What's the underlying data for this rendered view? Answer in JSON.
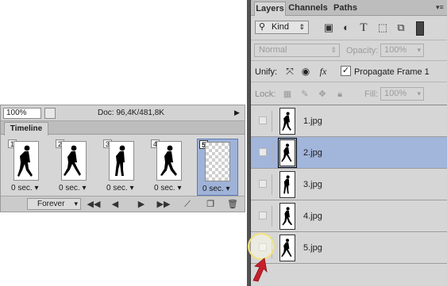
{
  "status_bar": {
    "zoom": "100%",
    "doc_info": "Doc: 96,4K/481,8K",
    "menu_arrow": "▶"
  },
  "timeline": {
    "tab_label": "Timeline",
    "frames": [
      {
        "number": "1",
        "delay": "0 sec.",
        "selected": false,
        "transparent": false
      },
      {
        "number": "2",
        "delay": "0 sec.",
        "selected": false,
        "transparent": false
      },
      {
        "number": "3",
        "delay": "0 sec.",
        "selected": false,
        "transparent": false
      },
      {
        "number": "4",
        "delay": "0 sec.",
        "selected": false,
        "transparent": false
      },
      {
        "number": "5",
        "delay": "0 sec.",
        "selected": true,
        "transparent": true
      }
    ],
    "loop_option": "Forever",
    "control_icons": [
      "first-frame-icon",
      "previous-frame-icon",
      "play-icon",
      "next-frame-icon",
      "tween-icon",
      "duplicate-frame-icon",
      "delete-frame-icon"
    ]
  },
  "layers_panel": {
    "tabs": [
      {
        "label": "Layers",
        "active": true
      },
      {
        "label": "Channels",
        "active": false
      },
      {
        "label": "Paths",
        "active": false
      }
    ],
    "filter": {
      "kind_label": "Kind",
      "icons": [
        "pixel-filter-icon",
        "adjustment-filter-icon",
        "type-filter-icon",
        "shape-filter-icon",
        "smart-object-filter-icon"
      ]
    },
    "blend_mode": "Normal",
    "opacity_label": "Opacity:",
    "opacity_value": "100%",
    "unify_label": "Unify:",
    "propagate_label": "Propagate Frame 1",
    "propagate_checked": true,
    "lock_label": "Lock:",
    "fill_label": "Fill:",
    "fill_value": "100%",
    "layers": [
      {
        "name": "1.jpg",
        "selected": false,
        "visible": false
      },
      {
        "name": "2.jpg",
        "selected": true,
        "visible": false
      },
      {
        "name": "3.jpg",
        "selected": false,
        "visible": false
      },
      {
        "name": "4.jpg",
        "selected": false,
        "visible": false
      },
      {
        "name": "5.jpg",
        "selected": false,
        "visible": false
      }
    ]
  },
  "colors": {
    "selection": "#a2b5da",
    "panel_bg": "#d6d6d6",
    "dark_chrome": "#535353",
    "highlight": "#f3e27d",
    "arrow": "#c8202a"
  }
}
